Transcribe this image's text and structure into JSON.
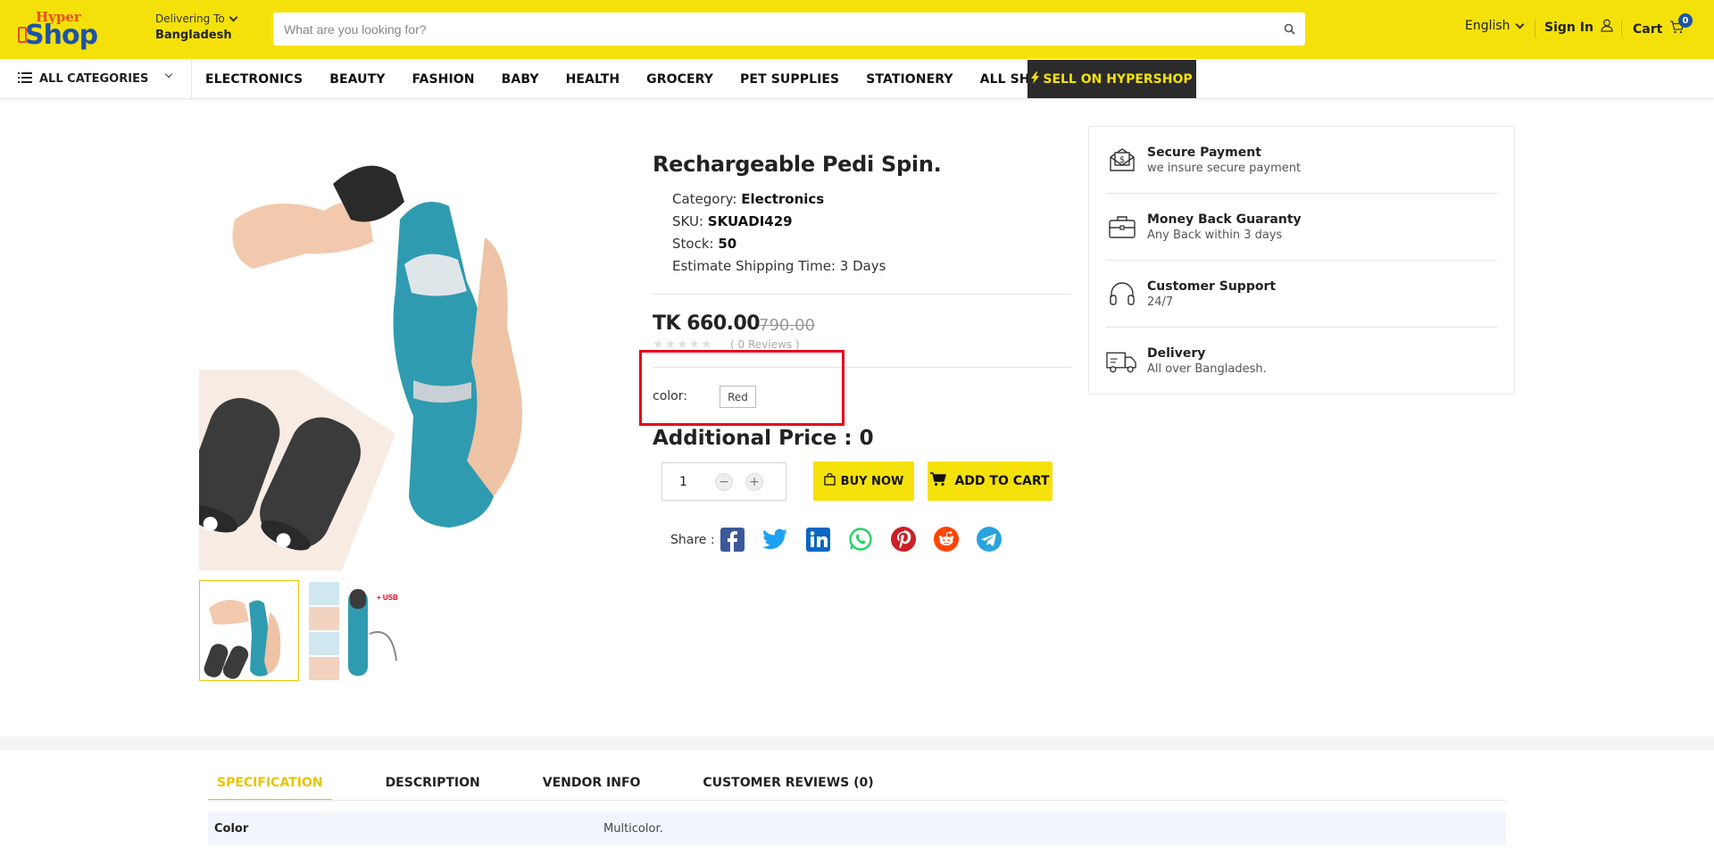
{
  "header": {
    "logo_top": "Hyper",
    "logo_main": "Shop",
    "delivering_label": "Delivering To",
    "delivering_value": "Bangladesh",
    "search_placeholder": "What are you looking for?",
    "language": "English",
    "signin": "Sign In",
    "cart_label": "Cart",
    "cart_count": "0"
  },
  "nav": {
    "all_categories": "ALL CATEGORIES",
    "links": [
      "ELECTRONICS",
      "BEAUTY",
      "FASHION",
      "BABY",
      "HEALTH",
      "GROCERY",
      "PET SUPPLIES",
      "STATIONERY",
      "ALL SHOP"
    ],
    "sell_button": "SELL ON HYPERSHOP"
  },
  "product": {
    "title": "Rechargeable Pedi Spin.",
    "category_label": "Category:",
    "category_value": "Electronics",
    "sku_label": "SKU:",
    "sku_value": "SKUADI429",
    "stock_label": "Stock:",
    "stock_value": "50",
    "shipping": "Estimate Shipping Time: 3 Days",
    "price": "TK 660.00",
    "old_price": "790.00",
    "stars": "★★★★★",
    "reviews": "( 0 Reviews )",
    "color_label": "color:",
    "color_value": "Red",
    "additional_price": "Additional Price : 0",
    "quantity": "1",
    "buy_now": "BUY NOW",
    "add_to_cart": "ADD TO CART",
    "share_label": "Share :"
  },
  "info": [
    {
      "title": "Secure Payment",
      "subtitle": "we insure secure payment",
      "icon": "secure-payment-icon"
    },
    {
      "title": "Money Back Guaranty",
      "subtitle": "Any Back within 3 days",
      "icon": "briefcase-icon"
    },
    {
      "title": "Customer Support",
      "subtitle": "24/7",
      "icon": "headphones-icon"
    },
    {
      "title": "Delivery",
      "subtitle": "All over Bangladesh.",
      "icon": "truck-icon"
    }
  ],
  "tabs": {
    "items": [
      "SPECIFICATION",
      "DESCRIPTION",
      "VENDOR INFO",
      "CUSTOMER REVIEWS (0)"
    ],
    "active": "SPECIFICATION"
  },
  "specification": [
    {
      "key": "Color",
      "value": "Multicolor."
    }
  ],
  "colors": {
    "accent_yellow": "#f5e10a",
    "brand_blue": "#1d54a8",
    "highlight_red": "#e8001c",
    "dark": "#2b2b2b"
  }
}
